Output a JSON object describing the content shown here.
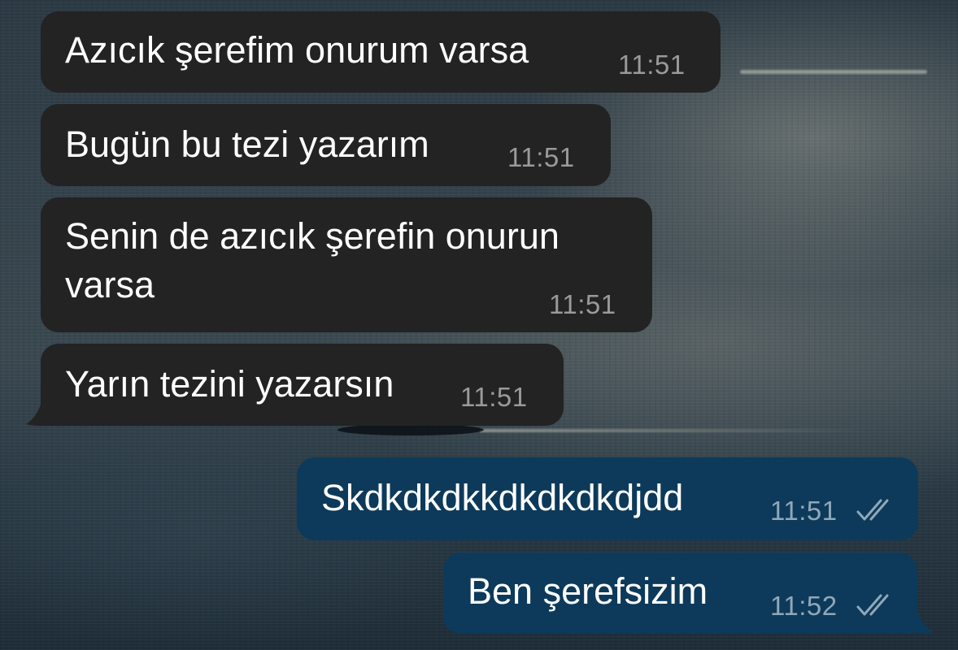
{
  "chat": {
    "messages": [
      {
        "direction": "incoming",
        "text": "Azıcık şerefim onurum varsa",
        "time": "11:51"
      },
      {
        "direction": "incoming",
        "text": "Bugün bu tezi yazarım",
        "time": "11:51"
      },
      {
        "direction": "incoming",
        "text": "Senin de azıcık şerefin onurun\nvarsa",
        "time": "11:51"
      },
      {
        "direction": "incoming",
        "text": "Yarın tezini yazarsın",
        "time": "11:51"
      },
      {
        "direction": "outgoing",
        "text": "Skdkdkdkkdkdkdkdjdd",
        "time": "11:51",
        "status_icon": "double-check-icon"
      },
      {
        "direction": "outgoing",
        "text": "Ben şerefsizim",
        "time": "11:52",
        "status_icon": "double-check-icon"
      }
    ]
  },
  "colors": {
    "incoming_bubble": "#232323",
    "outgoing_bubble": "#0d3a5a",
    "text": "#ffffff",
    "timestamp": "#9a9a9a"
  }
}
